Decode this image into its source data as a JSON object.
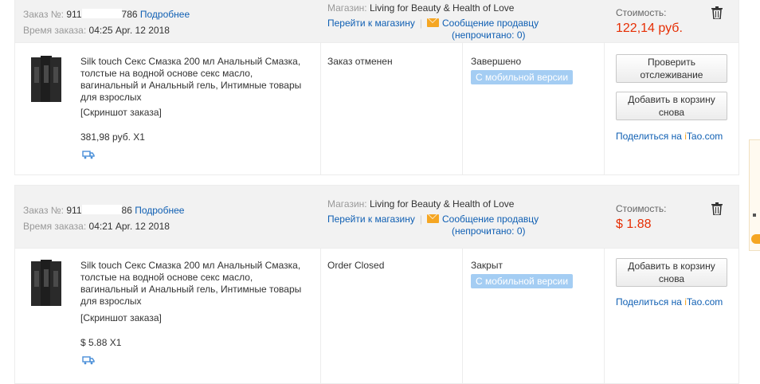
{
  "orders": [
    {
      "order_label": "Заказ №:",
      "order_number_start": "911",
      "order_number_end": "786",
      "details_link": "Подробнее",
      "time_label": "Время заказа:",
      "time_value": "04:25 Apr. 12 2018",
      "store_label": "Магазин:",
      "store_name": "Living for Beauty & Health of Love",
      "go_to_store": "Перейти к магазину",
      "message_seller": "Сообщение продавцу",
      "unread": "(непрочитано: 0)",
      "cost_label": "Стоимость:",
      "cost_value": "122,14 руб.",
      "product_title": "Silk touch Секс Смазка 200 мл Анальный Смазка, толстые на водной основе секс масло, вагинальный и Анальный гель, Интимные товары для взрослых",
      "screenshot_link": "[Скриншот заказа]",
      "price_qty": "381,98 руб. X1",
      "order_status": "Заказ отменен",
      "status2": "Завершено",
      "mobile_badge": "С мобильной версии",
      "buttons": [
        "Проверить отслеживание",
        "Добавить в корзину снова"
      ],
      "share_prefix": "Поделиться на ",
      "share_i": "i",
      "share_suffix": "Tao.com"
    },
    {
      "order_label": "Заказ №:",
      "order_number_start": "911",
      "order_number_end": "86",
      "details_link": "Подробнее",
      "time_label": "Время заказа:",
      "time_value": "04:21 Apr. 12 2018",
      "store_label": "Магазин:",
      "store_name": "Living for Beauty & Health of Love",
      "go_to_store": "Перейти к магазину",
      "message_seller": "Сообщение продавцу",
      "unread": "(непрочитано: 0)",
      "cost_label": "Стоимость:",
      "cost_value": "$ 1.88",
      "product_title": "Silk touch Секс Смазка 200 мл Анальный Смазка, толстые на водной основе секс масло, вагинальный и Анальный гель, Интимные товары для взрослых",
      "screenshot_link": "[Скриншот заказа]",
      "price_qty": "$ 5.88 X1",
      "order_status": "Order Closed",
      "status2": "Закрыт",
      "mobile_badge": "С мобильной версии",
      "buttons": [
        "Добавить в корзину снова"
      ],
      "share_prefix": "Поделиться на ",
      "share_i": "i",
      "share_suffix": "Tao.com"
    }
  ],
  "colors": {
    "price_red": "#e62e04",
    "link_blue": "#0f5fb3",
    "badge_blue": "#a4cdf3",
    "header_bg": "#f2f2f2"
  }
}
